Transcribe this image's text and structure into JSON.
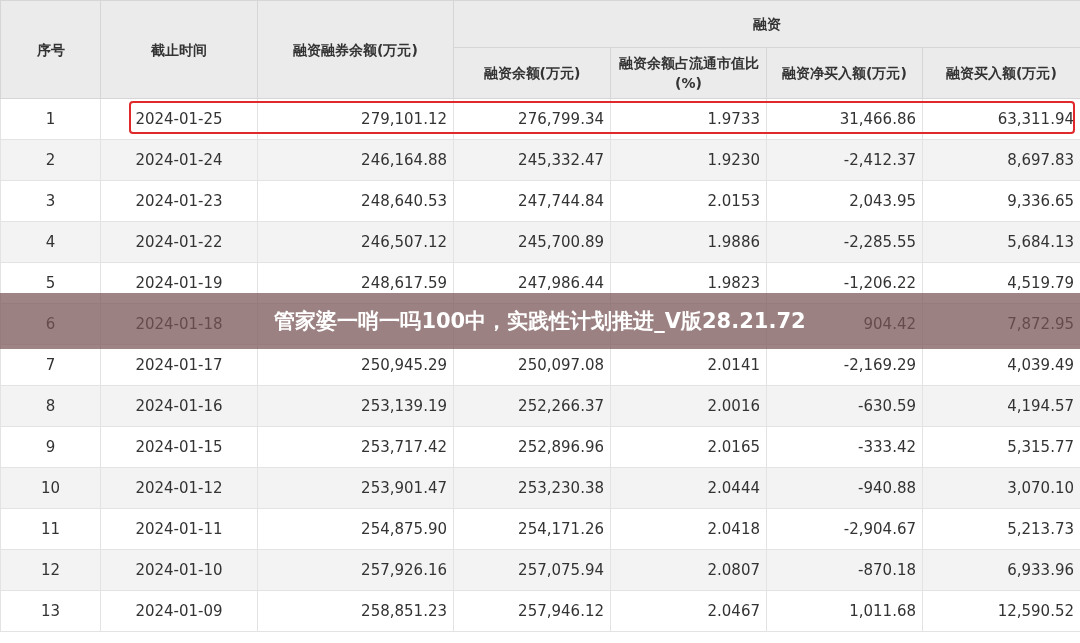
{
  "table": {
    "group_header": "融资",
    "columns": [
      "序号",
      "截止时间",
      "融资融券余额(万元)",
      "融资余额(万元)",
      "融资余额占流通市值比(%)",
      "融资净买入额(万元)",
      "融资买入额(万元)"
    ],
    "rows": [
      {
        "cells": [
          "1",
          "2024-01-25",
          "279,101.12",
          "276,799.34",
          "1.9733",
          "31,466.86",
          "63,311.94"
        ],
        "highlighted": true
      },
      {
        "cells": [
          "2",
          "2024-01-24",
          "246,164.88",
          "245,332.47",
          "1.9230",
          "-2,412.37",
          "8,697.83"
        ],
        "highlighted": false
      },
      {
        "cells": [
          "3",
          "2024-01-23",
          "248,640.53",
          "247,744.84",
          "2.0153",
          "2,043.95",
          "9,336.65"
        ],
        "highlighted": false
      },
      {
        "cells": [
          "4",
          "2024-01-22",
          "246,507.12",
          "245,700.89",
          "1.9886",
          "-2,285.55",
          "5,684.13"
        ],
        "highlighted": false
      },
      {
        "cells": [
          "5",
          "2024-01-19",
          "248,617.59",
          "247,986.44",
          "1.9823",
          "-1,206.22",
          "4,519.79"
        ],
        "highlighted": false
      },
      {
        "cells": [
          "6",
          "2024-01-18",
          "",
          "",
          "",
          "904.42",
          "7,872.95"
        ],
        "highlighted": false
      },
      {
        "cells": [
          "7",
          "2024-01-17",
          "250,945.29",
          "250,097.08",
          "2.0141",
          "-2,169.29",
          "4,039.49"
        ],
        "highlighted": false
      },
      {
        "cells": [
          "8",
          "2024-01-16",
          "253,139.19",
          "252,266.37",
          "2.0016",
          "-630.59",
          "4,194.57"
        ],
        "highlighted": false
      },
      {
        "cells": [
          "9",
          "2024-01-15",
          "253,717.42",
          "252,896.96",
          "2.0165",
          "-333.42",
          "5,315.77"
        ],
        "highlighted": false
      },
      {
        "cells": [
          "10",
          "2024-01-12",
          "253,901.47",
          "253,230.38",
          "2.0444",
          "-940.88",
          "3,070.10"
        ],
        "highlighted": false
      },
      {
        "cells": [
          "11",
          "2024-01-11",
          "254,875.90",
          "254,171.26",
          "2.0418",
          "-2,904.67",
          "5,213.73"
        ],
        "highlighted": false
      },
      {
        "cells": [
          "12",
          "2024-01-10",
          "257,926.16",
          "257,075.94",
          "2.0807",
          "-870.18",
          "6,933.96"
        ],
        "highlighted": false
      },
      {
        "cells": [
          "13",
          "2024-01-09",
          "258,851.23",
          "257,946.12",
          "2.0467",
          "1,011.68",
          "12,590.52"
        ],
        "highlighted": false
      }
    ]
  },
  "banner": {
    "text": "管家婆一哨一吗100中，实践性计划推进_V版28.21.72"
  }
}
